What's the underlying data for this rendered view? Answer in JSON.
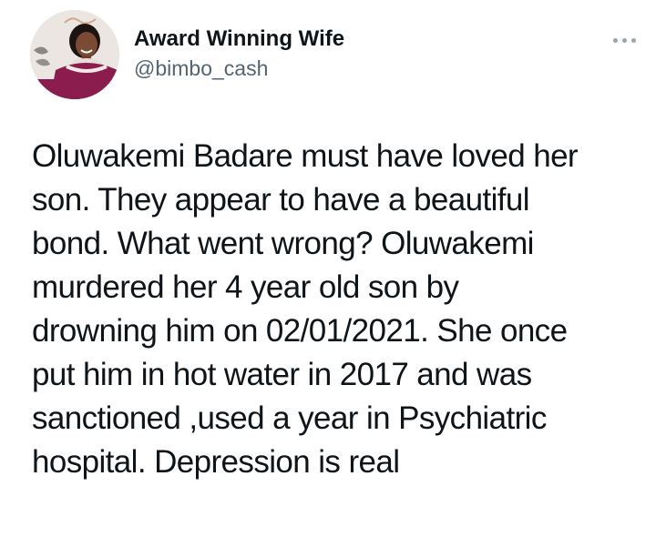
{
  "author": {
    "display_name": "Award Winning Wife",
    "handle": "@bimbo_cash",
    "avatar_icon": "profile-photo"
  },
  "menu": {
    "icon": "more-options-icon"
  },
  "tweet": {
    "lines": [
      "Oluwakemi Badare must have loved her",
      "son. They appear to have a beautiful",
      "bond. What went wrong? Oluwakemi",
      "murdered her 4 year old son by",
      "drowning him on 02/01/2021. She once",
      "put him in hot water in 2017 and was",
      "sanctioned ,used a year in Psychiatric",
      "hospital. Depression is real"
    ]
  },
  "colors": {
    "text": "#0f1419",
    "secondary": "#536471",
    "avatar_top": "#e9e4e2",
    "avatar_bottom": "#8b1c4f"
  }
}
